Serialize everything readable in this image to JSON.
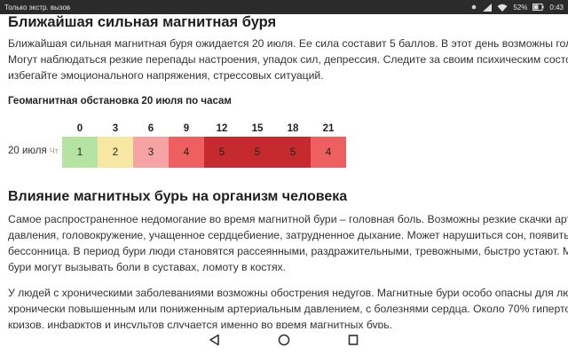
{
  "status_bar": {
    "left_text": "Только экстр. вызов",
    "battery": "52%",
    "time": "0:43",
    "icons": [
      "notification-dot-icon",
      "signal-icon",
      "wifi-icon",
      "battery-icon"
    ]
  },
  "article": {
    "title": "Ближайшая сильная магнитная буря",
    "intro_lines": [
      "Ближайшая сильная магнитная буря ожидается 20 июля. Ее сила составит 5 баллов. В этот день возможны головные бо",
      "Могут наблюдаться резкие перепады настроения, упадок сил, депрессия. Следите за своим психическим состоянием:",
      "избегайте эмоционального напряжения, стрессовых ситуаций."
    ],
    "geo_heading": "Геомагнитная обстановка 20 июля по часам",
    "geo_table": {
      "date_label": "20 июля",
      "day_label": "Чт",
      "hours": [
        "0",
        "3",
        "6",
        "9",
        "12",
        "15",
        "18",
        "21"
      ],
      "values": [
        "1",
        "2",
        "3",
        "4",
        "5",
        "5",
        "5",
        "4"
      ]
    },
    "section_heading": "Влияние магнитных бурь на организм человека",
    "section_p1_lines": [
      "Самое распространенное недомогание во время магнитной бури – головная боль. Возможны резкие скачки артериальн",
      "давления, головокружение, учащенное сердцебиение, затрудненное дыхание. Может нарушиться сон, появиться",
      "бессонница. В период бури люди становятся рассеянными, раздражительными, тревожными, быстро устают. Магнитны",
      "бури могут вызывать боли в суставах, ломоту в костях."
    ],
    "section_p2_lines": [
      "У людей с хроническими заболеваниями возможны обострения недугов. Магнитные бури особо опасны для людей с",
      "хронически повышенным или пониженным артериальным давлением, с болезнями сердца. Около 70% гипертонических",
      "кризов, инфарктов и инсультов случается именно во время магнитных бурь."
    ]
  },
  "level_colors": {
    "1": "#b5e3a1",
    "2": "#f6e7a2",
    "3": "#f5a3a3",
    "4": "#ee5f5f",
    "5": "#c42a2e"
  },
  "nav_bar": {
    "buttons": [
      "back-icon",
      "home-icon",
      "recents-icon"
    ]
  }
}
